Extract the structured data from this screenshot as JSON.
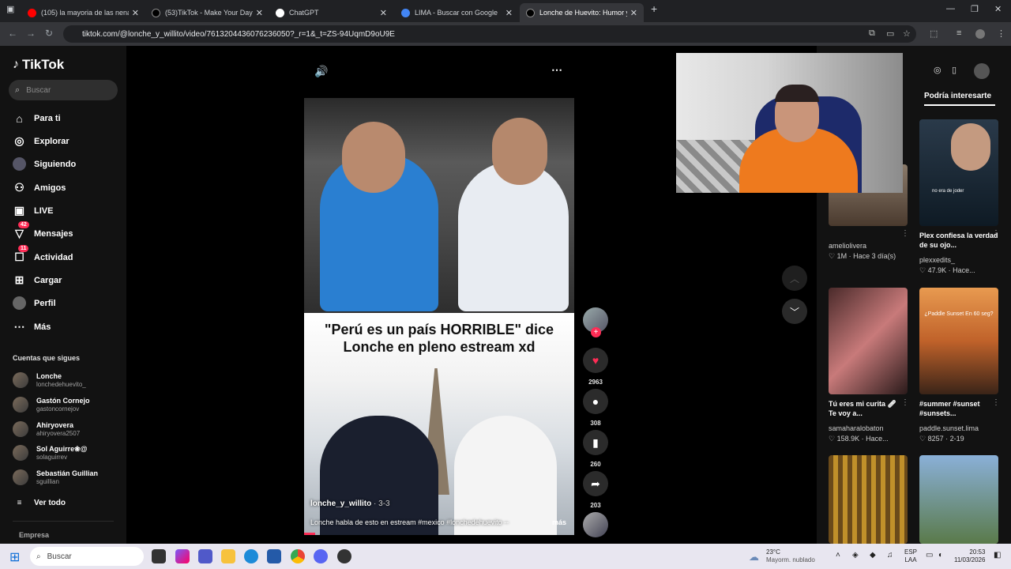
{
  "browser": {
    "tabs": [
      {
        "label": "(105) la mayoria de las nena lin",
        "fav_color": "#ff0000"
      },
      {
        "label": "(53)TikTok - Make Your Day",
        "fav_color": "#000000"
      },
      {
        "label": "ChatGPT",
        "fav_color": "#ffffff"
      },
      {
        "label": "LIMA - Buscar con Google",
        "fav_color": "#4285f4"
      },
      {
        "label": "Lonche de Huevito: Humor y C",
        "fav_color": "#000000"
      }
    ],
    "url": "tiktok.com/@lonche_y_willito/video/7613204436076236050?_r=1&_t=ZS-94UqmD9oU9E"
  },
  "sidebar": {
    "logo": "TikTok",
    "search_placeholder": "Buscar",
    "nav": [
      {
        "label": "Para ti",
        "icon": "home-icon"
      },
      {
        "label": "Explorar",
        "icon": "compass-icon"
      },
      {
        "label": "Siguiendo",
        "icon": "avatar-icon"
      },
      {
        "label": "Amigos",
        "icon": "friends-icon"
      },
      {
        "label": "LIVE",
        "icon": "live-icon"
      },
      {
        "label": "Mensajes",
        "icon": "message-icon",
        "badge": "42"
      },
      {
        "label": "Actividad",
        "icon": "activity-icon",
        "badge": "11"
      },
      {
        "label": "Cargar",
        "icon": "upload-icon"
      },
      {
        "label": "Perfil",
        "icon": "profile-icon"
      },
      {
        "label": "Más",
        "icon": "more-icon"
      }
    ],
    "following_title": "Cuentas que sigues",
    "following": [
      {
        "name": "Lonche",
        "handle": "lonchedehuevito_"
      },
      {
        "name": "Gastón Cornejo",
        "handle": "gastoncornejov"
      },
      {
        "name": "Ahiryovera",
        "handle": "ahiryovera2507"
      },
      {
        "name": "Sol Aguirre❀@",
        "handle": "solaguirrev"
      },
      {
        "name": "Sebastián Guillian",
        "handle": "sguillian"
      }
    ],
    "see_all": "Ver todo",
    "company": "Empresa"
  },
  "video": {
    "caption": "\"Perú es un país HORRIBLE\" dice Lonche en pleno estream xd",
    "author": "lonche_y_willito",
    "date": "3-3",
    "description": "Lonche habla de esto en estream #mexico #lonchedehuevito --",
    "more": "más"
  },
  "actions": {
    "likes": "2963",
    "comments": "308",
    "saves": "260",
    "shares": "203"
  },
  "right": {
    "tab": "Podría interesarte",
    "cards": [
      {
        "text": "",
        "user": "ameliolivera",
        "stat": "1M · Hace 3 día(s)"
      },
      {
        "text": "Plex confiesa la verdad de su ojo...",
        "user": "plexxedits_",
        "stat": "47.9K · Hace..."
      },
      {
        "text": "Tú eres mi curita 🩹 Te voy a...",
        "user": "samaharalobaton",
        "stat": "158.9K · Hace..."
      },
      {
        "text": "#summer #sunset #sunsets...",
        "user": "paddle.sunset.lima",
        "stat": "8257 · 2-19"
      }
    ],
    "thumb_text_1": "no era de joder",
    "thumb_text_2": "¿Paddle Sunset En 60 seg?"
  },
  "taskbar": {
    "search": "Buscar",
    "weather_temp": "23°C",
    "weather_desc": "Mayorm. nublado",
    "lang": "ESP",
    "lang2": "LAA",
    "time": "20:53",
    "date": "11/03/2026"
  }
}
